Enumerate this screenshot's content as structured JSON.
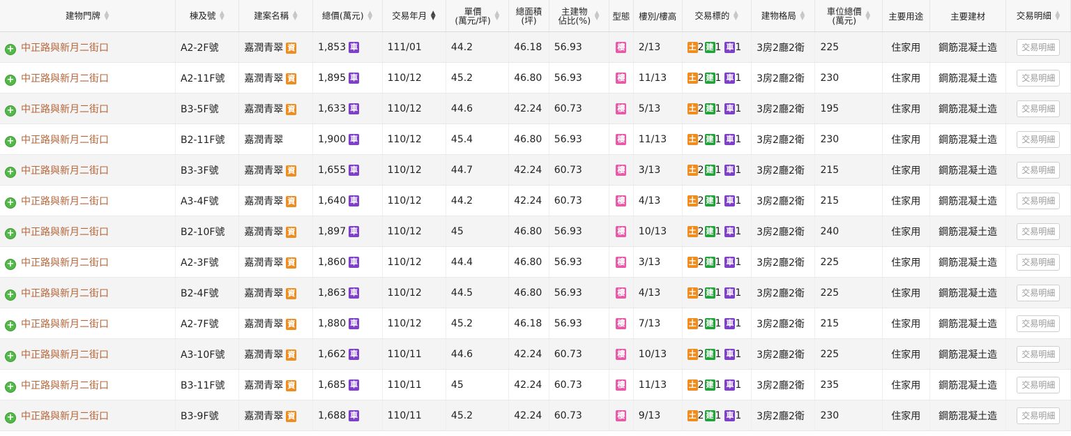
{
  "headers": [
    {
      "lines": [
        "建物門牌"
      ],
      "sort": true,
      "active": false
    },
    {
      "lines": [
        "棟及號"
      ],
      "sort": true,
      "active": false
    },
    {
      "lines": [
        "建案名稱"
      ],
      "sort": true,
      "active": false
    },
    {
      "lines": [
        "總價(萬元)"
      ],
      "sort": true,
      "active": false
    },
    {
      "lines": [
        "交易年月"
      ],
      "sort": true,
      "active": true
    },
    {
      "lines": [
        "單價",
        "(萬元/坪)"
      ],
      "sort": true,
      "active": false
    },
    {
      "lines": [
        "總面積",
        "(坪)"
      ],
      "sort": false,
      "active": false
    },
    {
      "lines": [
        "主建物",
        "佔比(%)"
      ],
      "sort": true,
      "active": false
    },
    {
      "lines": [
        "型態"
      ],
      "sort": false,
      "active": false
    },
    {
      "lines": [
        "樓別/樓高"
      ],
      "sort": false,
      "active": false
    },
    {
      "lines": [
        "交易標的"
      ],
      "sort": true,
      "active": false
    },
    {
      "lines": [
        "建物格局"
      ],
      "sort": true,
      "active": false
    },
    {
      "lines": [
        "車位總價",
        "(萬元)"
      ],
      "sort": true,
      "active": false
    },
    {
      "lines": [
        "主要用途"
      ],
      "sort": false,
      "active": false
    },
    {
      "lines": [
        "主要建材"
      ],
      "sort": false,
      "active": false
    },
    {
      "lines": [
        "交易明細"
      ],
      "sort": true,
      "active": false
    }
  ],
  "badges": {
    "zi": "資",
    "che": "車",
    "lou": "樓",
    "tu": "土",
    "jian": "建"
  },
  "rows": [
    {
      "address": "中正路與新月二街口",
      "unit": "A2-2F號",
      "project": "嘉潤青翠",
      "has_info": true,
      "total_price": "1,853",
      "date": "111/01",
      "unit_price": "44.2",
      "area": "46.18",
      "main_ratio": "56.93",
      "floor": "2/13",
      "land": "2",
      "building": "1",
      "parking": "1",
      "layout": "3房2廳2衛",
      "parking_price": "225",
      "use": "住家用",
      "material": "鋼筋混凝土造",
      "detail": "交易明細"
    },
    {
      "address": "中正路與新月二街口",
      "unit": "A2-11F號",
      "project": "嘉潤青翠",
      "has_info": true,
      "total_price": "1,895",
      "date": "110/12",
      "unit_price": "45.2",
      "area": "46.80",
      "main_ratio": "56.93",
      "floor": "11/13",
      "land": "2",
      "building": "1",
      "parking": "1",
      "layout": "3房2廳2衛",
      "parking_price": "230",
      "use": "住家用",
      "material": "鋼筋混凝土造",
      "detail": "交易明細"
    },
    {
      "address": "中正路與新月二街口",
      "unit": "B3-5F號",
      "project": "嘉潤青翠",
      "has_info": true,
      "total_price": "1,633",
      "date": "110/12",
      "unit_price": "44.6",
      "area": "42.24",
      "main_ratio": "60.73",
      "floor": "5/13",
      "land": "2",
      "building": "1",
      "parking": "1",
      "layout": "3房2廳2衛",
      "parking_price": "195",
      "use": "住家用",
      "material": "鋼筋混凝土造",
      "detail": "交易明細"
    },
    {
      "address": "中正路與新月二街口",
      "unit": "B2-11F號",
      "project": "嘉潤青翠",
      "has_info": false,
      "total_price": "1,900",
      "date": "110/12",
      "unit_price": "45.4",
      "area": "46.80",
      "main_ratio": "56.93",
      "floor": "11/13",
      "land": "2",
      "building": "1",
      "parking": "1",
      "layout": "3房2廳2衛",
      "parking_price": "230",
      "use": "住家用",
      "material": "鋼筋混凝土造",
      "detail": "交易明細"
    },
    {
      "address": "中正路與新月二街口",
      "unit": "B3-3F號",
      "project": "嘉潤青翠",
      "has_info": true,
      "total_price": "1,655",
      "date": "110/12",
      "unit_price": "44.7",
      "area": "42.24",
      "main_ratio": "60.73",
      "floor": "3/13",
      "land": "2",
      "building": "1",
      "parking": "1",
      "layout": "3房2廳2衛",
      "parking_price": "215",
      "use": "住家用",
      "material": "鋼筋混凝土造",
      "detail": "交易明細"
    },
    {
      "address": "中正路與新月二街口",
      "unit": "A3-4F號",
      "project": "嘉潤青翠",
      "has_info": true,
      "total_price": "1,640",
      "date": "110/12",
      "unit_price": "44.2",
      "area": "42.24",
      "main_ratio": "60.73",
      "floor": "4/13",
      "land": "2",
      "building": "1",
      "parking": "1",
      "layout": "3房2廳2衛",
      "parking_price": "215",
      "use": "住家用",
      "material": "鋼筋混凝土造",
      "detail": "交易明細"
    },
    {
      "address": "中正路與新月二街口",
      "unit": "B2-10F號",
      "project": "嘉潤青翠",
      "has_info": true,
      "total_price": "1,897",
      "date": "110/12",
      "unit_price": "45",
      "area": "46.80",
      "main_ratio": "56.93",
      "floor": "10/13",
      "land": "2",
      "building": "1",
      "parking": "1",
      "layout": "3房2廳2衛",
      "parking_price": "240",
      "use": "住家用",
      "material": "鋼筋混凝土造",
      "detail": "交易明細"
    },
    {
      "address": "中正路與新月二街口",
      "unit": "A2-3F號",
      "project": "嘉潤青翠",
      "has_info": true,
      "total_price": "1,860",
      "date": "110/12",
      "unit_price": "44.4",
      "area": "46.80",
      "main_ratio": "56.93",
      "floor": "3/13",
      "land": "2",
      "building": "1",
      "parking": "1",
      "layout": "3房2廳2衛",
      "parking_price": "225",
      "use": "住家用",
      "material": "鋼筋混凝土造",
      "detail": "交易明細"
    },
    {
      "address": "中正路與新月二街口",
      "unit": "B2-4F號",
      "project": "嘉潤青翠",
      "has_info": true,
      "total_price": "1,863",
      "date": "110/12",
      "unit_price": "44.5",
      "area": "46.80",
      "main_ratio": "56.93",
      "floor": "4/13",
      "land": "2",
      "building": "1",
      "parking": "1",
      "layout": "3房2廳2衛",
      "parking_price": "225",
      "use": "住家用",
      "material": "鋼筋混凝土造",
      "detail": "交易明細"
    },
    {
      "address": "中正路與新月二街口",
      "unit": "A2-7F號",
      "project": "嘉潤青翠",
      "has_info": true,
      "total_price": "1,880",
      "date": "110/12",
      "unit_price": "45.2",
      "area": "46.18",
      "main_ratio": "56.93",
      "floor": "7/13",
      "land": "2",
      "building": "1",
      "parking": "1",
      "layout": "3房2廳2衛",
      "parking_price": "215",
      "use": "住家用",
      "material": "鋼筋混凝土造",
      "detail": "交易明細"
    },
    {
      "address": "中正路與新月二街口",
      "unit": "A3-10F號",
      "project": "嘉潤青翠",
      "has_info": true,
      "total_price": "1,662",
      "date": "110/11",
      "unit_price": "44.6",
      "area": "42.24",
      "main_ratio": "60.73",
      "floor": "10/13",
      "land": "2",
      "building": "1",
      "parking": "1",
      "layout": "3房2廳2衛",
      "parking_price": "225",
      "use": "住家用",
      "material": "鋼筋混凝土造",
      "detail": "交易明細"
    },
    {
      "address": "中正路與新月二街口",
      "unit": "B3-11F號",
      "project": "嘉潤青翠",
      "has_info": true,
      "total_price": "1,685",
      "date": "110/11",
      "unit_price": "45",
      "area": "42.24",
      "main_ratio": "60.73",
      "floor": "11/13",
      "land": "2",
      "building": "1",
      "parking": "1",
      "layout": "3房2廳2衛",
      "parking_price": "235",
      "use": "住家用",
      "material": "鋼筋混凝土造",
      "detail": "交易明細"
    },
    {
      "address": "中正路與新月二街口",
      "unit": "B3-9F號",
      "project": "嘉潤青翠",
      "has_info": true,
      "total_price": "1,688",
      "date": "110/11",
      "unit_price": "45.2",
      "area": "42.24",
      "main_ratio": "60.73",
      "floor": "9/13",
      "land": "2",
      "building": "1",
      "parking": "1",
      "layout": "3房2廳2衛",
      "parking_price": "230",
      "use": "住家用",
      "material": "鋼筋混凝土造",
      "detail": "交易明細"
    }
  ]
}
